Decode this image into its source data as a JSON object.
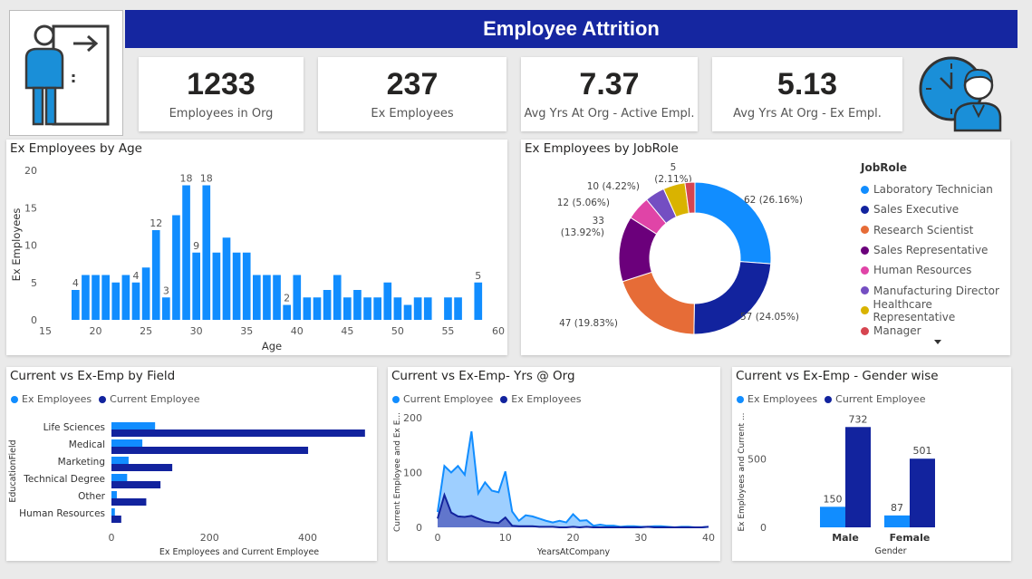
{
  "header": {
    "title": "Employee Attrition"
  },
  "kpis": [
    {
      "value": "1233",
      "label": "Employees in Org"
    },
    {
      "value": "237",
      "label": "Ex Employees"
    },
    {
      "value": "7.37",
      "label": "Avg Yrs At Org - Active Empl."
    },
    {
      "value": "5.13",
      "label": "Avg Yrs At Org - Ex Empl."
    }
  ],
  "icons": {
    "left": "person-leaving-door-icon",
    "right": "clock-employee-icon"
  },
  "colors": {
    "light_blue": "#118dff",
    "dark_blue": "#12239e",
    "title_bar": "#1526a0"
  },
  "chart_data": [
    {
      "id": "age",
      "type": "bar",
      "title": "Ex Employees by Age",
      "xlabel": "Age",
      "ylabel": "Ex Employees",
      "xlim": [
        15,
        60
      ],
      "ylim": [
        0,
        20
      ],
      "xticks": [
        "15",
        "20",
        "25",
        "30",
        "35",
        "40",
        "45",
        "50",
        "55",
        "60"
      ],
      "yticks": [
        "0",
        "5",
        "10",
        "15",
        "20"
      ],
      "x": [
        18,
        19,
        20,
        21,
        22,
        23,
        24,
        25,
        26,
        27,
        28,
        29,
        30,
        31,
        32,
        33,
        34,
        35,
        36,
        37,
        38,
        39,
        40,
        41,
        42,
        43,
        44,
        45,
        46,
        47,
        48,
        49,
        50,
        51,
        52,
        53,
        55,
        56,
        58
      ],
      "values": [
        4,
        6,
        6,
        6,
        5,
        6,
        5,
        7,
        12,
        3,
        14,
        18,
        9,
        18,
        9,
        11,
        9,
        9,
        6,
        6,
        6,
        2,
        6,
        3,
        3,
        4,
        6,
        3,
        4,
        3,
        3,
        5,
        3,
        2,
        3,
        3,
        3,
        3,
        5
      ],
      "labels": {
        "18": "4",
        "24": "4",
        "26": "12",
        "27": "3",
        "29": "18",
        "30": "9",
        "31": "18",
        "39": "2",
        "58": "5"
      },
      "color": "#118dff"
    },
    {
      "id": "jobrole",
      "type": "pie",
      "title": "Ex Employees by JobRole",
      "legend_title": "JobRole",
      "slices": [
        {
          "name": "Laboratory Technician",
          "value": 62,
          "label": "62 (26.16%)",
          "color": "#118dff"
        },
        {
          "name": "Sales Executive",
          "value": 57,
          "label": "57 (24.05%)",
          "color": "#12239e"
        },
        {
          "name": "Research Scientist",
          "value": 47,
          "label": "47 (19.83%)",
          "color": "#e66c37"
        },
        {
          "name": "Sales Representative",
          "value": 33,
          "label": "33\n(13.92%)",
          "color": "#6b007b"
        },
        {
          "name": "Human Resources",
          "value": 12,
          "label": "12 (5.06%)",
          "color": "#e044a7"
        },
        {
          "name": "Manufacturing Director",
          "value": 10,
          "label": "10 (4.22%)",
          "color": "#744ec2"
        },
        {
          "name": "Healthcare Representative",
          "value": 11,
          "label": "5\n(2.11%)",
          "color": "#d9b300"
        },
        {
          "name": "Manager",
          "value": 5,
          "label": "",
          "color": "#d64550"
        }
      ]
    },
    {
      "id": "field",
      "type": "bar",
      "orientation": "horizontal",
      "title": "Current vs Ex-Emp by Field",
      "ylabel": "EducationField",
      "xlabel": "Ex Employees and Current Employee",
      "xlim": [
        0,
        500
      ],
      "xticks": [
        "0",
        "200",
        "400"
      ],
      "categories": [
        "Life Sciences",
        "Medical",
        "Marketing",
        "Technical Degree",
        "Other",
        "Human Resources"
      ],
      "series": [
        {
          "name": "Ex Employees",
          "values": [
            89,
            63,
            35,
            32,
            11,
            7
          ],
          "color": "#118dff"
        },
        {
          "name": "Current Employee",
          "values": [
            517,
            401,
            124,
            100,
            71,
            20
          ],
          "color": "#12239e"
        }
      ]
    },
    {
      "id": "yrs",
      "type": "area",
      "title": "Current vs Ex-Emp- Yrs @ Org",
      "xlabel": "YearsAtCompany",
      "ylabel": "Current Employee and Ex E...",
      "xlim": [
        0,
        40
      ],
      "ylim": [
        0,
        200
      ],
      "xticks": [
        "0",
        "10",
        "20",
        "30",
        "40"
      ],
      "yticks": [
        "0",
        "100",
        "200"
      ],
      "x": [
        0,
        1,
        2,
        3,
        4,
        5,
        6,
        7,
        8,
        9,
        10,
        11,
        12,
        13,
        14,
        15,
        16,
        17,
        18,
        19,
        20,
        21,
        22,
        23,
        24,
        25,
        26,
        27,
        28,
        29,
        30,
        31,
        32,
        33,
        34,
        35,
        36,
        37,
        38,
        39,
        40
      ],
      "series": [
        {
          "name": "Current Employee",
          "values": [
            28,
            112,
            100,
            112,
            96,
            175,
            62,
            82,
            67,
            64,
            102,
            29,
            12,
            22,
            20,
            16,
            12,
            9,
            12,
            9,
            24,
            12,
            13,
            3,
            5,
            3,
            3,
            1,
            2,
            2,
            1,
            1,
            2,
            2,
            1,
            0,
            1,
            1,
            0,
            0,
            1
          ],
          "color": "#118dff"
        },
        {
          "name": "Ex Employees",
          "values": [
            16,
            59,
            27,
            20,
            19,
            21,
            16,
            11,
            9,
            8,
            18,
            3,
            2,
            2,
            2,
            1,
            1,
            1,
            0,
            0,
            1,
            0,
            1,
            0,
            0,
            0,
            0,
            0,
            0,
            0,
            0,
            1,
            0,
            0,
            0,
            0,
            0,
            0,
            0,
            0,
            1
          ],
          "color": "#12239e"
        }
      ]
    },
    {
      "id": "gender",
      "type": "bar",
      "title": "Current vs Ex-Emp - Gender wise",
      "xlabel": "Gender",
      "ylabel": "Ex Employees and Current ...",
      "ylim": [
        0,
        800
      ],
      "yticks": [
        "0",
        "500"
      ],
      "categories": [
        "Male",
        "Female"
      ],
      "series": [
        {
          "name": "Ex Employees",
          "values": [
            150,
            87
          ],
          "labels": [
            "150",
            "87"
          ],
          "color": "#118dff"
        },
        {
          "name": "Current Employee",
          "values": [
            732,
            501
          ],
          "labels": [
            "732",
            "501"
          ],
          "color": "#12239e"
        }
      ]
    }
  ]
}
